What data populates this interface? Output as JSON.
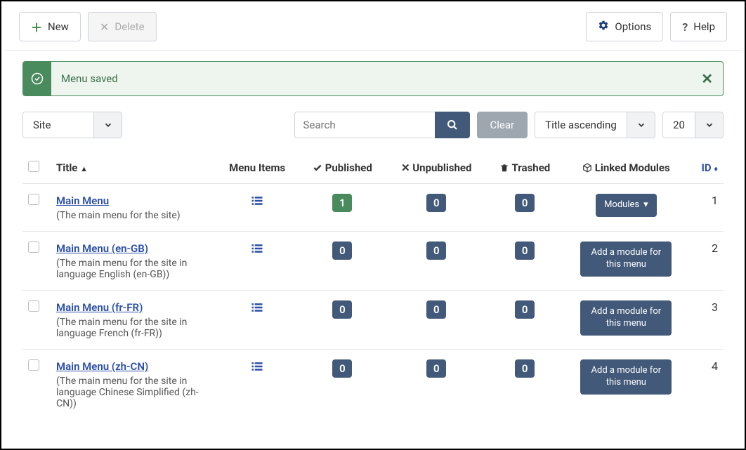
{
  "toolbar": {
    "new_label": "New",
    "delete_label": "Delete",
    "options_label": "Options",
    "help_label": "Help"
  },
  "alert": {
    "message": "Menu saved"
  },
  "filters": {
    "site_label": "Site",
    "search_placeholder": "Search",
    "clear_label": "Clear",
    "sort_label": "Title ascending",
    "limit_label": "20"
  },
  "columns": {
    "title": "Title",
    "menu_items": "Menu Items",
    "published": "Published",
    "unpublished": "Unpublished",
    "trashed": "Trashed",
    "linked": "Linked Modules",
    "id": "ID"
  },
  "modules_button": "Modules",
  "add_module_button": "Add a module for this menu",
  "rows": [
    {
      "title": "Main Menu",
      "desc": "(The main menu for the site)",
      "published": "1",
      "unpublished": "0",
      "trashed": "0",
      "linked_type": "modules",
      "id": "1"
    },
    {
      "title": "Main Menu (en-GB)",
      "desc": "(The main menu for the site in language English (en-GB))",
      "published": "0",
      "unpublished": "0",
      "trashed": "0",
      "linked_type": "add",
      "id": "2"
    },
    {
      "title": "Main Menu (fr-FR)",
      "desc": "(The main menu for the site in language French (fr-FR))",
      "published": "0",
      "unpublished": "0",
      "trashed": "0",
      "linked_type": "add",
      "id": "3"
    },
    {
      "title": "Main Menu (zh-CN)",
      "desc": "(The main menu for the site in language Chinese Simplified (zh-CN))",
      "published": "0",
      "unpublished": "0",
      "trashed": "0",
      "linked_type": "add",
      "id": "4"
    }
  ]
}
